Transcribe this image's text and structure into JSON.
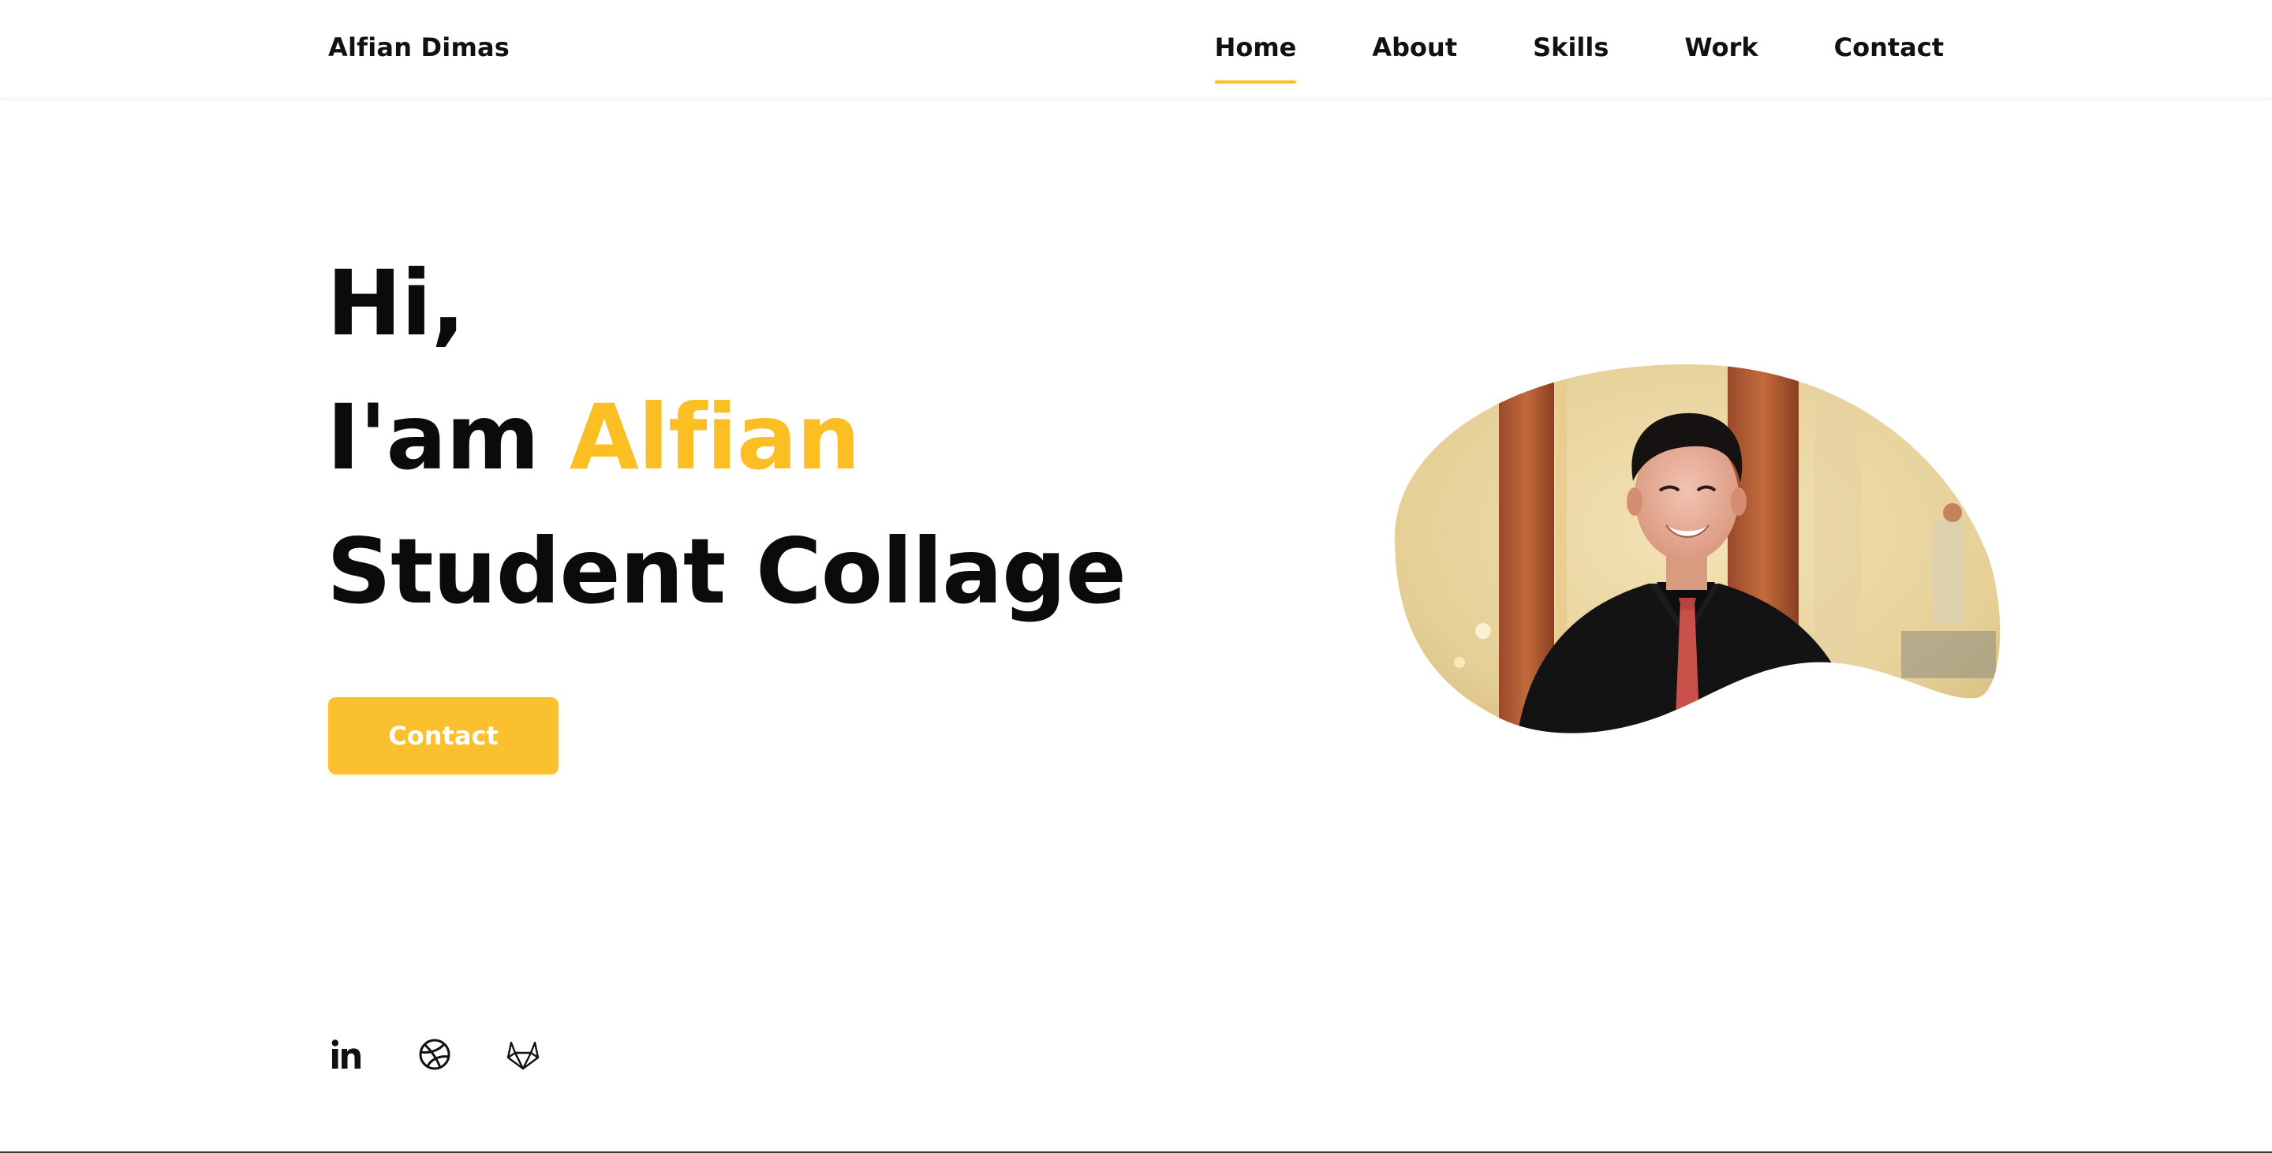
{
  "header": {
    "brand": "Alfian Dimas",
    "nav": [
      {
        "label": "Home",
        "active": true
      },
      {
        "label": "About",
        "active": false
      },
      {
        "label": "Skills",
        "active": false
      },
      {
        "label": "Work",
        "active": false
      },
      {
        "label": "Contact",
        "active": false
      }
    ]
  },
  "hero": {
    "greeting": "Hi,",
    "intro_prefix": "I'am ",
    "name": "Alfian",
    "role": "Student Collage",
    "button_label": "Contact"
  },
  "socials": [
    {
      "icon": "linkedin-icon"
    },
    {
      "icon": "dribbble-icon"
    },
    {
      "icon": "gitlab-icon"
    }
  ],
  "colors": {
    "accent": "#fbbf24",
    "text": "#0b0b0b",
    "background": "#ffffff"
  }
}
